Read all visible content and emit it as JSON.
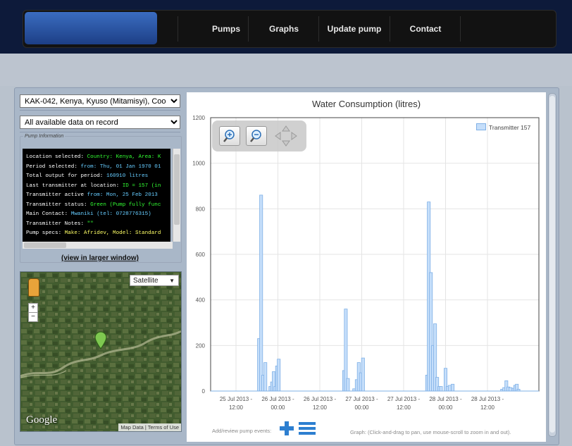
{
  "nav": {
    "items": [
      "Pumps",
      "Graphs",
      "Update pump",
      "Contact"
    ]
  },
  "controls": {
    "location_select": "KAK-042, Kenya, Kyuso (Mitamisyi),   Coo",
    "period_select": "All available data on record"
  },
  "pump_info": {
    "legend": "Pump Information",
    "lines": [
      [
        {
          "t": "Location selected: ",
          "c": "lbl"
        },
        {
          "t": "Country: Kenya, Area: K",
          "c": "grn"
        }
      ],
      [
        {
          "t": "Period selected: ",
          "c": "lbl"
        },
        {
          "t": "from: Thu, 01 Jan 1970 01",
          "c": "cyan"
        }
      ],
      [
        {
          "t": "Total output for period: ",
          "c": "lbl"
        },
        {
          "t": "160910 litres",
          "c": "cyan"
        }
      ],
      [
        {
          "t": "Last transmitter at location: ",
          "c": "lbl"
        },
        {
          "t": "ID = 157 (in",
          "c": "grn"
        }
      ],
      [
        {
          "t": "Transmitter active ",
          "c": "lbl"
        },
        {
          "t": "from: Mon, 25 Feb 2013",
          "c": "cyan"
        }
      ],
      [
        {
          "t": "Transmitter status: ",
          "c": "lbl"
        },
        {
          "t": "Green (Pump fully func",
          "c": "grn"
        }
      ],
      [
        {
          "t": "Main Contact: ",
          "c": "lbl"
        },
        {
          "t": "Mwaniki (tel: 0728776315)",
          "c": "cyan"
        }
      ],
      [
        {
          "t": "Transmitter Notes: ",
          "c": "lbl"
        },
        {
          "t": "\"\"",
          "c": "grn"
        }
      ],
      [
        {
          "t": "Pump specs: ",
          "c": "lbl"
        },
        {
          "t": "Make: Afridev, Model: Standard",
          "c": "yel"
        }
      ]
    ],
    "view_link": "(view in larger window)"
  },
  "map": {
    "type_select": "Satellite",
    "zoom_in": "+",
    "zoom_out": "−",
    "logo": "Google",
    "footer": "Map Data | Terms of Use",
    "colors": {
      "forest": "#3e5a2e",
      "marker": "#7ec850"
    }
  },
  "chart_data": {
    "type": "bar",
    "title": "Water Consumption (litres)",
    "ylim": [
      0,
      1200
    ],
    "yticks": [
      0,
      200,
      400,
      600,
      800,
      1000,
      1200
    ],
    "xlabels": [
      [
        "25 Jul 2013 -",
        "12:00"
      ],
      [
        "26 Jul 2013 -",
        "00:00"
      ],
      [
        "26 Jul 2013 -",
        "12:00"
      ],
      [
        "27 Jul 2013 -",
        "00:00"
      ],
      [
        "27 Jul 2013 -",
        "12:00"
      ],
      [
        "28 Jul 2013 -",
        "00:00"
      ],
      [
        "28 Jul 2013 -",
        "12:00"
      ]
    ],
    "legend_position": "top-right",
    "grid": true,
    "series": [
      {
        "name": "Transmitter 157",
        "color": "#c5defa",
        "edge": "#7fb0e6",
        "points": [
          [
            0.55,
            230
          ],
          [
            0.6,
            860
          ],
          [
            0.65,
            70
          ],
          [
            0.7,
            125
          ],
          [
            0.82,
            20
          ],
          [
            0.86,
            40
          ],
          [
            0.9,
            85
          ],
          [
            0.94,
            20
          ],
          [
            0.98,
            110
          ],
          [
            1.02,
            140
          ],
          [
            2.58,
            90
          ],
          [
            2.62,
            360
          ],
          [
            2.67,
            55
          ],
          [
            2.82,
            10
          ],
          [
            2.88,
            50
          ],
          [
            2.93,
            125
          ],
          [
            2.98,
            80
          ],
          [
            3.03,
            145
          ],
          [
            4.56,
            70
          ],
          [
            4.6,
            830
          ],
          [
            4.65,
            520
          ],
          [
            4.7,
            200
          ],
          [
            4.75,
            295
          ],
          [
            4.8,
            60
          ],
          [
            4.85,
            20
          ],
          [
            4.89,
            20
          ],
          [
            5.0,
            100
          ],
          [
            5.05,
            20
          ],
          [
            5.1,
            25
          ],
          [
            5.17,
            30
          ],
          [
            6.35,
            8
          ],
          [
            6.4,
            15
          ],
          [
            6.45,
            45
          ],
          [
            6.5,
            18
          ],
          [
            6.55,
            15
          ],
          [
            6.62,
            12
          ],
          [
            6.66,
            25
          ],
          [
            6.7,
            30
          ],
          [
            6.74,
            8
          ]
        ]
      }
    ]
  },
  "chart_footer": {
    "left": "Add/review pump events:",
    "right": "Graph: (Click-and-drag to pan, use mouse-scroll to zoom in and out)."
  }
}
